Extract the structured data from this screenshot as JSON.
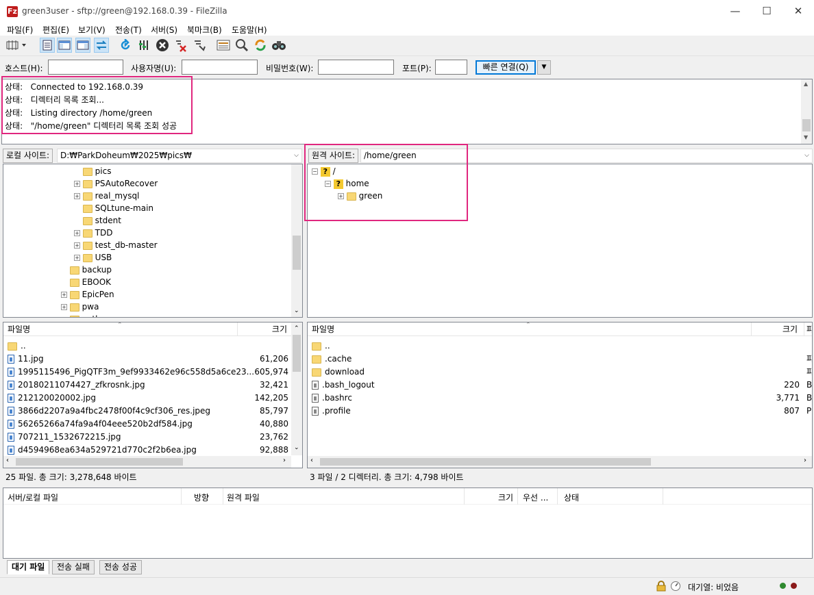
{
  "window": {
    "title": "green3user - sftp://green@192.168.0.39 - FileZilla",
    "app_icon": "Fz",
    "minimize": "—",
    "maximize": "☐",
    "close": "✕"
  },
  "menu": [
    "파일(F)",
    "편집(E)",
    "보기(V)",
    "전송(T)",
    "서버(S)",
    "북마크(B)",
    "도움말(H)"
  ],
  "quickconnect": {
    "host_label": "호스트(H):",
    "user_label": "사용자명(U):",
    "pass_label": "비밀번호(W):",
    "port_label": "포트(P):",
    "host_value": "",
    "user_value": "",
    "pass_value": "",
    "port_value": "",
    "connect_button": "빠른 연결(Q)",
    "dropdown_arrow": "▼"
  },
  "log": [
    {
      "label": "상태:",
      "text": "Connected to 192.168.0.39"
    },
    {
      "label": "상태:",
      "text": "디렉터리 목록 조회..."
    },
    {
      "label": "상태:",
      "text": "Listing directory /home/green"
    },
    {
      "label": "상태:",
      "text": "\"/home/green\" 디렉터리 목록 조회 성공"
    }
  ],
  "local": {
    "site_label": "로컬 사이트:",
    "path": "D:₩ParkDoheum₩2025₩pics₩",
    "tree": [
      {
        "name": "pics",
        "expander": ""
      },
      {
        "name": "PSAutoRecover",
        "expander": "+"
      },
      {
        "name": "real_mysql",
        "expander": "+"
      },
      {
        "name": "SQLtune-main",
        "expander": ""
      },
      {
        "name": "stdent",
        "expander": ""
      },
      {
        "name": "TDD",
        "expander": "+"
      },
      {
        "name": "test_db-master",
        "expander": "+"
      },
      {
        "name": "USB",
        "expander": "+"
      },
      {
        "name": "backup",
        "expander": ""
      },
      {
        "name": "EBOOK",
        "expander": ""
      },
      {
        "name": "EpicPen",
        "expander": "+"
      },
      {
        "name": "pwa",
        "expander": "+"
      },
      {
        "name": "python",
        "expander": ""
      }
    ],
    "col_name": "파일명",
    "col_size": "크기",
    "files": [
      {
        "name": "..",
        "size": "",
        "icon": "folder"
      },
      {
        "name": "11.jpg",
        "size": "61,206",
        "icon": "image"
      },
      {
        "name": "1995115496_PigQTF3m_9ef9933462e96c558d5a6ce23...",
        "size": "605,974",
        "icon": "image"
      },
      {
        "name": "20180211074427_zfkrosnk.jpg",
        "size": "32,421",
        "icon": "image"
      },
      {
        "name": "212120020002.jpg",
        "size": "142,205",
        "icon": "image"
      },
      {
        "name": "3866d2207a9a4fbc2478f00f4c9cf306_res.jpeg",
        "size": "85,797",
        "icon": "image"
      },
      {
        "name": "56265266a74fa9a4f04eee520b2df584.jpg",
        "size": "40,880",
        "icon": "image"
      },
      {
        "name": "707211_1532672215.jpg",
        "size": "23,762",
        "icon": "image"
      },
      {
        "name": "d4594968ea634a529721d770c2f2b6ea.jpg",
        "size": "92,888",
        "icon": "image"
      }
    ],
    "status": "25 파일. 총 크기: 3,278,648 바이트"
  },
  "remote": {
    "site_label": "원격 사이트:",
    "path": "/home/green",
    "tree": [
      {
        "name": "/",
        "expander": "−"
      },
      {
        "name": "home",
        "expander": "−"
      },
      {
        "name": "green",
        "expander": "+"
      }
    ],
    "col_name": "파일명",
    "col_size": "크기",
    "col_type": "파",
    "files": [
      {
        "name": "..",
        "size": "",
        "type": "",
        "icon": "folder"
      },
      {
        "name": ".cache",
        "size": "",
        "type": "파",
        "icon": "folder"
      },
      {
        "name": "download",
        "size": "",
        "type": "파",
        "icon": "folder"
      },
      {
        "name": ".bash_logout",
        "size": "220",
        "type": "B",
        "icon": "doc"
      },
      {
        "name": ".bashrc",
        "size": "3,771",
        "type": "B",
        "icon": "doc"
      },
      {
        "name": ".profile",
        "size": "807",
        "type": "P",
        "icon": "doc"
      }
    ],
    "status": "3 파일 / 2 디렉터리. 총 크기: 4,798 바이트"
  },
  "queue": {
    "col_server": "서버/로컬 파일",
    "col_direction": "방향",
    "col_remote": "원격 파일",
    "col_size": "크기",
    "col_priority": "우선 ...",
    "col_status": "상태"
  },
  "tabs": [
    "대기 파일",
    "전송 실패",
    "전송 성공"
  ],
  "statusbar": {
    "queue": "대기열: 비었음"
  },
  "colors": {
    "highlight": "#e0267e",
    "accent": "#0078d7"
  }
}
